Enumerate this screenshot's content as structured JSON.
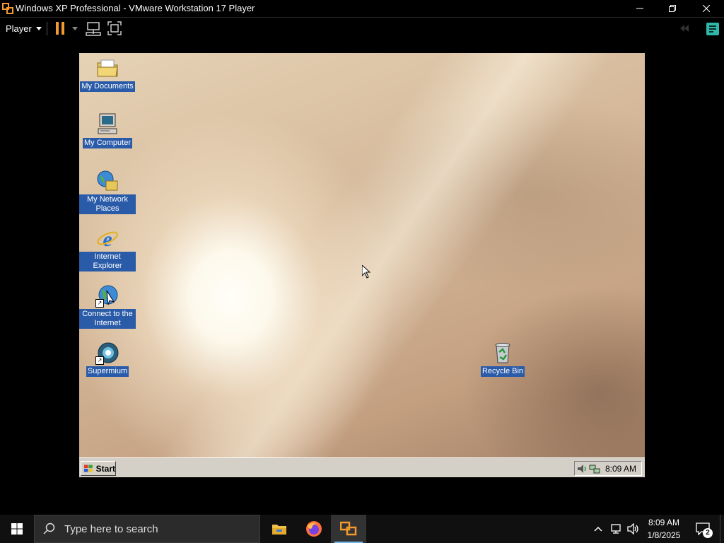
{
  "vmware": {
    "window_title": "Windows XP Professional - VMware Workstation 17 Player",
    "player_menu_label": "Player",
    "accent_color": "#f29a2e"
  },
  "guest": {
    "desktop_icons": [
      {
        "label": "My Documents",
        "icon": "folder-icon"
      },
      {
        "label": "My Computer",
        "icon": "computer-icon"
      },
      {
        "label": "My Network Places",
        "icon": "network-places-icon"
      },
      {
        "label": "Internet Explorer",
        "icon": "ie-icon"
      },
      {
        "label": "Connect to the Internet",
        "icon": "connect-internet-icon"
      },
      {
        "label": "Supermium",
        "icon": "supermium-icon"
      },
      {
        "label": "Recycle Bin",
        "icon": "recycle-bin-icon"
      }
    ],
    "taskbar": {
      "start_label": "Start",
      "clock": "8:09 AM"
    }
  },
  "host": {
    "search_placeholder": "Type here to search",
    "pinned_apps": [
      "file-explorer",
      "firefox",
      "vmware-player"
    ],
    "clock_time": "8:09 AM",
    "clock_date": "1/8/2025",
    "notification_count": "2"
  }
}
